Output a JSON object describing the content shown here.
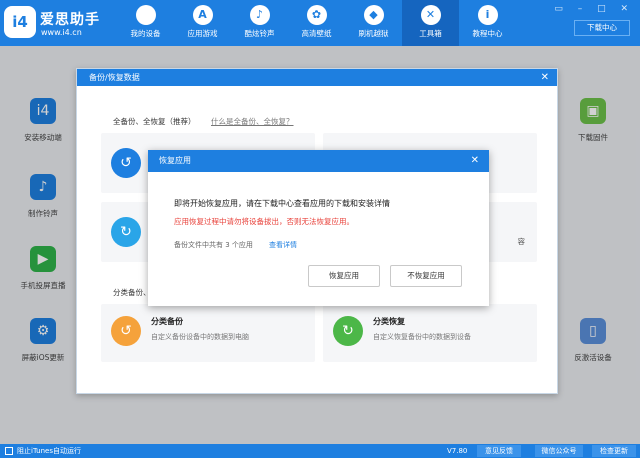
{
  "brand": {
    "logo_text": "i4",
    "name": "爱思助手",
    "url": "www.i4.cn"
  },
  "nav": {
    "items": [
      {
        "label": "我的设备",
        "icon": "apple-icon"
      },
      {
        "label": "应用游戏",
        "icon": "appstore-icon"
      },
      {
        "label": "酷炫铃声",
        "icon": "bell-icon"
      },
      {
        "label": "高清壁纸",
        "icon": "flower-icon"
      },
      {
        "label": "刷机越狱",
        "icon": "dropbox-icon"
      },
      {
        "label": "工具箱",
        "icon": "tools-icon"
      },
      {
        "label": "教程中心",
        "icon": "info-icon"
      }
    ],
    "active_index": 5,
    "download_label": "下载中心",
    "window_controls": "▭ – □ ✕"
  },
  "tools": {
    "left": [
      {
        "label": "安装移动端",
        "icon": "i4-app-icon",
        "color": "#1e7fe0"
      },
      {
        "label": "制作铃声",
        "icon": "bell-icon",
        "color": "#1e7fe0"
      },
      {
        "label": "手机投屏直播",
        "icon": "screen-mirror-icon",
        "color": "#2fb34a"
      },
      {
        "label": "屏蔽iOS更新",
        "icon": "gear-icon",
        "color": "#1e7fe0"
      }
    ],
    "right": [
      {
        "label": "下载固件",
        "icon": "cube-icon",
        "color": "#6cc04a"
      },
      {
        "label": "反激活设备",
        "icon": "phone-icon",
        "color": "#5b8fd9"
      }
    ]
  },
  "backup_dialog": {
    "title": "备份/恢复数据",
    "section_full": "全备份、全恢复（推荐）",
    "section_full_link": "什么是全备份、全恢复？",
    "partial_header": "分类备份、",
    "hidden_card_text": "容",
    "cards": [
      {
        "title": "分类备份",
        "desc": "自定义备份设备中的数据到电脑",
        "color": "#f5a23b"
      },
      {
        "title": "分类恢复",
        "desc": "自定义恢复备份中的数据到设备",
        "color": "#4cb748"
      }
    ]
  },
  "restore_modal": {
    "title": "恢复应用",
    "message": "即将开始恢复应用，请在下载中心查看应用的下载和安装详情",
    "warning": "应用恢复过程中请勿将设备拔出，否则无法恢复应用。",
    "info": "备份文件中共有 3 个应用",
    "details_link": "查看详情",
    "confirm_label": "恢复应用",
    "cancel_label": "不恢复应用"
  },
  "footer": {
    "itunes_label": "阻止iTunes自动运行",
    "version": "V7.80",
    "buttons": [
      "意见反馈",
      "微信公众号",
      "检查更新"
    ]
  },
  "colors": {
    "brand_blue": "#1e7fe0",
    "warning_red": "#e8413a"
  }
}
